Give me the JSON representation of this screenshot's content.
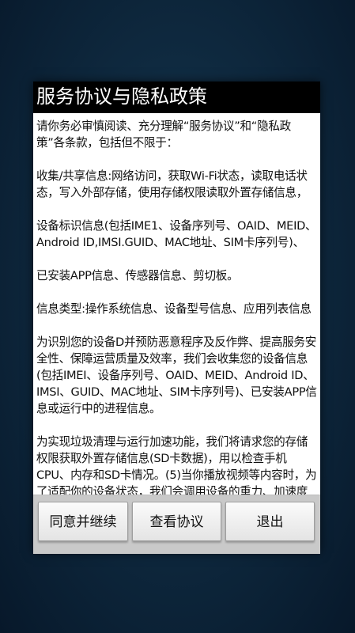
{
  "dialog": {
    "title": "服务协议与隐私政策",
    "paragraphs": [
      "请你务必审慎阅读、充分理解“服务协议”和“隐私政策”各条款，包括但不限于：",
      "收集/共享信息:网络访问，获取Wi-Fi状态，读取电话状态，写入外部存储，使用存储权限读取外置存储信息，",
      "设备标识信息(包括IME1、设备序列号、OAID、MEID、 Android ID,IMSI.GUID、MAC地址、SIM卡序列号)、",
      "已安装APP信息、传感器信息、剪切板。",
      "信息类型:操作系统信息、设备型号信息、应用列表信息",
      "为识别您的设备D并预防恶意程序及反作弊、提高服务安全性、保障运营质量及效率，我们会收集您的设备信息(包括IMEI、设备序列号、OAID、MEID、Android ID、 IMSI、GUID、MAC地址、SIM卡序列号)、已安装APP信息或运行中的进程信息。",
      "为实现垃圾清理与运行加速功能，我们将请求您的存储权限获取外置存储信息(SD卡数据)，用以检查手机CPU、内存和SD卡情况。(5)当你播放视频等内容时，为了适配你的设备状态，我们会调用设备的重力、加速度等传感器信息，以识别你的设备横竖屏状态。"
    ]
  },
  "buttons": {
    "agree": "同意并继续",
    "view": "查看协议",
    "exit": "退出"
  }
}
